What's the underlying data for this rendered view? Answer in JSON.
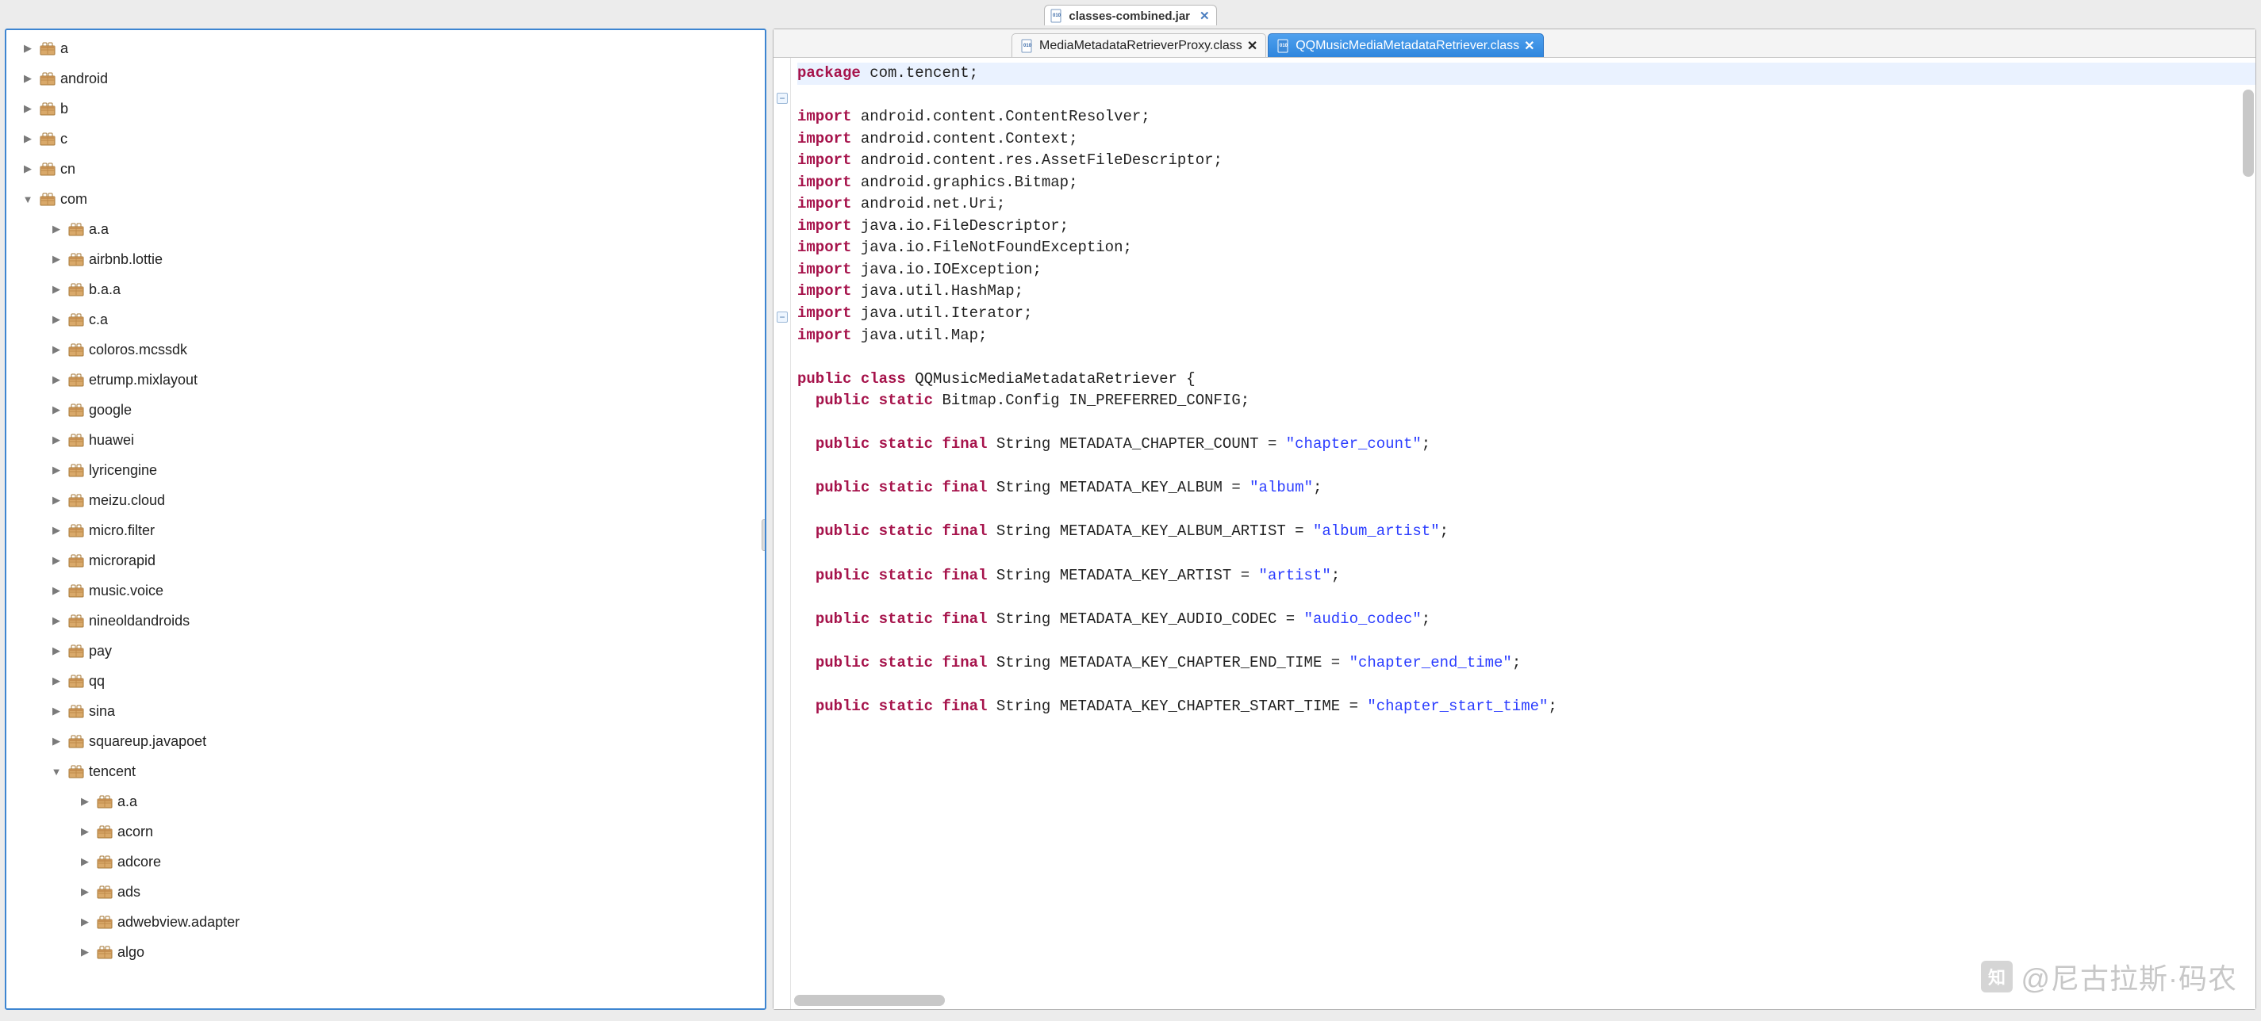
{
  "top_tab": {
    "label": "classes-combined.jar",
    "close": "✕"
  },
  "tree": {
    "roots": [
      {
        "label": "a",
        "expanded": false,
        "depth": 0
      },
      {
        "label": "android",
        "expanded": false,
        "depth": 0
      },
      {
        "label": "b",
        "expanded": false,
        "depth": 0
      },
      {
        "label": "c",
        "expanded": false,
        "depth": 0
      },
      {
        "label": "cn",
        "expanded": false,
        "depth": 0
      },
      {
        "label": "com",
        "expanded": true,
        "depth": 0,
        "children": [
          {
            "label": "a.a",
            "depth": 1
          },
          {
            "label": "airbnb.lottie",
            "depth": 1
          },
          {
            "label": "b.a.a",
            "depth": 1
          },
          {
            "label": "c.a",
            "depth": 1
          },
          {
            "label": "coloros.mcssdk",
            "depth": 1
          },
          {
            "label": "etrump.mixlayout",
            "depth": 1
          },
          {
            "label": "google",
            "depth": 1
          },
          {
            "label": "huawei",
            "depth": 1
          },
          {
            "label": "lyricengine",
            "depth": 1
          },
          {
            "label": "meizu.cloud",
            "depth": 1
          },
          {
            "label": "micro.filter",
            "depth": 1
          },
          {
            "label": "microrapid",
            "depth": 1
          },
          {
            "label": "music.voice",
            "depth": 1
          },
          {
            "label": "nineoldandroids",
            "depth": 1
          },
          {
            "label": "pay",
            "depth": 1
          },
          {
            "label": "qq",
            "depth": 1
          },
          {
            "label": "sina",
            "depth": 1
          },
          {
            "label": "squareup.javapoet",
            "depth": 1
          },
          {
            "label": "tencent",
            "expanded": true,
            "depth": 1,
            "children": [
              {
                "label": "a.a",
                "depth": 2
              },
              {
                "label": "acorn",
                "depth": 2
              },
              {
                "label": "adcore",
                "depth": 2
              },
              {
                "label": "ads",
                "depth": 2
              },
              {
                "label": "adwebview.adapter",
                "depth": 2
              },
              {
                "label": "algo",
                "depth": 2
              }
            ]
          }
        ]
      }
    ]
  },
  "editor_tabs": [
    {
      "label": "MediaMetadataRetrieverProxy.class",
      "active": false,
      "close": "✕"
    },
    {
      "label": "QQMusicMediaMetadataRetriever.class",
      "active": true,
      "close": "✕"
    }
  ],
  "code": {
    "package_kw": "package",
    "package_name": " com.tencent;",
    "import_kw": "import",
    "imports": [
      " android.content.ContentResolver;",
      " android.content.Context;",
      " android.content.res.AssetFileDescriptor;",
      " android.graphics.Bitmap;",
      " android.net.Uri;",
      " java.io.FileDescriptor;",
      " java.io.FileNotFoundException;",
      " java.io.IOException;",
      " java.util.HashMap;",
      " java.util.Iterator;",
      " java.util.Map;"
    ],
    "class_decl": {
      "public": "public ",
      "class": "class ",
      "name": "QQMusicMediaMetadataRetriever {",
      "static": "static ",
      "final": "final "
    },
    "field0": {
      "pre": "  ",
      "public": "public ",
      "static": "static ",
      "rest": "Bitmap.Config IN_PREFERRED_CONFIG;"
    },
    "string_fields": [
      {
        "name": "METADATA_CHAPTER_COUNT",
        "val": "\"chapter_count\""
      },
      {
        "name": "METADATA_KEY_ALBUM",
        "val": "\"album\""
      },
      {
        "name": "METADATA_KEY_ALBUM_ARTIST",
        "val": "\"album_artist\""
      },
      {
        "name": "METADATA_KEY_ARTIST",
        "val": "\"artist\""
      },
      {
        "name": "METADATA_KEY_AUDIO_CODEC",
        "val": "\"audio_codec\""
      },
      {
        "name": "METADATA_KEY_CHAPTER_END_TIME",
        "val": "\"chapter_end_time\""
      },
      {
        "name": "METADATA_KEY_CHAPTER_START_TIME",
        "val": "\"chapter_start_time\""
      }
    ]
  },
  "watermark": {
    "icon": "知",
    "text": "@尼古拉斯·码农"
  }
}
